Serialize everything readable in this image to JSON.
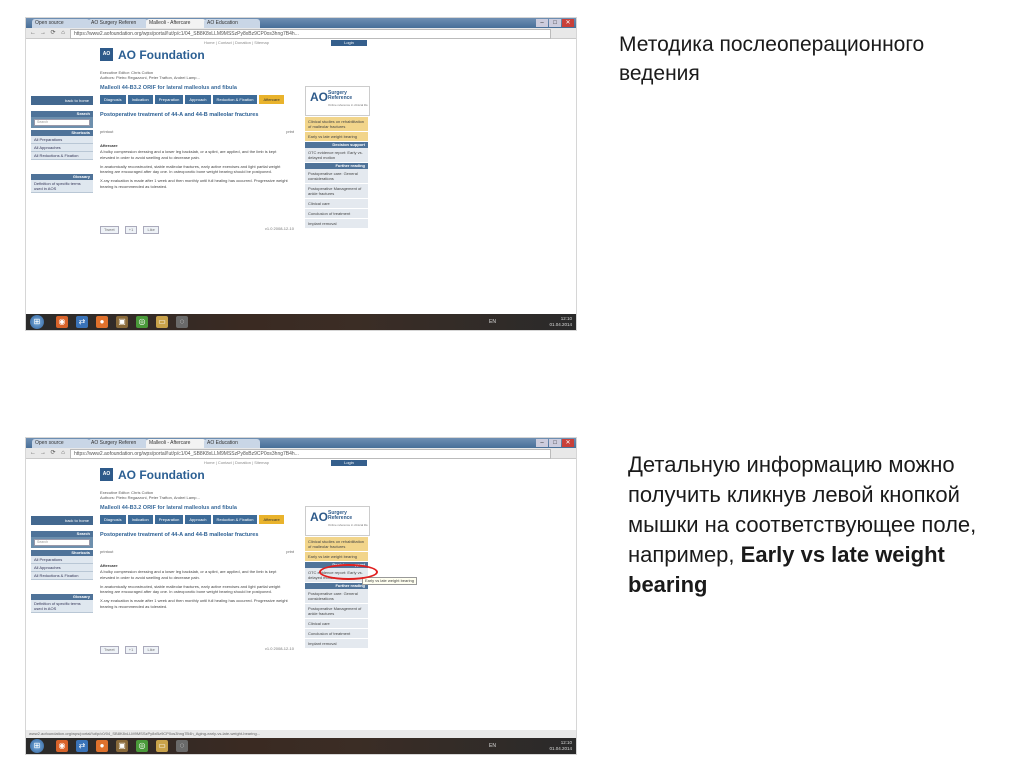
{
  "slides": {
    "caption1": "Методика послеоперационного ведения",
    "caption2_prefix": "Детальную информацию можно получить кликнув левой кнопкой мышки на соответствующее поле, например, ",
    "caption2_bold": "Early vs late weight bearing"
  },
  "browser": {
    "tabs": [
      "Open source",
      "AO Surgery Referen",
      "Malleoli - Aftercare",
      "AO Education"
    ],
    "url": "https://www2.aofoundation.org/wps/portal/!ut/p/c1/04_SB8K8xLLM9MSSzPy8xBz9CP0os3hng7B4h...",
    "window_buttons": [
      "–",
      "□",
      "✕"
    ],
    "nav_icons": [
      "←",
      "→",
      "⟳",
      "⌂"
    ]
  },
  "page": {
    "top_links": "Home | Contact | Donation | Sitemap",
    "login": "Login",
    "logo_mark": "AO",
    "org_name": "AO Foundation",
    "editors_line1": "Executive Editor: Chris Colton",
    "editors_line2": "Authors: Pietro Regazzoni, Peter Trafton, Andrei Lamp...",
    "title": "Malleoli 44-B3.2 ORIF for lateral malleolus and fibula",
    "nav_tabs": [
      "Diagnosis",
      "Indication",
      "Preparation",
      "Approach",
      "Reduction & Fixation",
      "Aftercare"
    ],
    "active_tab": "Aftercare",
    "section_title": "Postoperative treatment of 44-A and 44-B malleolar fractures",
    "print_left": "printout",
    "print_right": "print",
    "aftercare_heading": "Aftercare",
    "paragraphs": [
      "A bulky compression dressing and a lower leg backslab, or a splint, are applied, and the limb is kept elevated in order to avoid swelling and to decrease pain.",
      "In anatomically reconstructed, stable malleolar fractures, early active exercises and light partial weight bearing are encouraged after day one. In osteoporotic bone weight bearing should be postponed.",
      "X-ray evaluation is made after 1 week and then monthly until full healing has occurred. Progressive weight bearing is recommended as tolerated."
    ],
    "social": [
      "Tweet",
      "+1",
      "Like"
    ],
    "social_date": "v1.0 2008-12-10"
  },
  "left_sidebar": {
    "back_label": "back to home",
    "search_header": "Search",
    "search_placeholder": "Search",
    "shortcuts_header": "Shortcuts",
    "shortcuts": [
      "All Preparations",
      "All Approaches",
      "All Reductions & Fixation"
    ],
    "glossary_header": "Glossary",
    "glossary_item": "Definition of specific terms used in AOS"
  },
  "right_sidebar": {
    "brand_big": "AO",
    "brand_line1": "Surgery",
    "brand_line2": "Reference",
    "brand_tag": "Online reference in clinical life",
    "yellow_items": [
      "Clinical studies on rehabilitation of malleolar fractures",
      "Early vs late weight bearing"
    ],
    "decision_header": "Decision support",
    "decision_item": "OTC evidence report: Early vs. delayed motion",
    "further_header": "Further reading",
    "further_items": [
      "Postoperative care: General considerations",
      "Postoperative Management of ankle fractures",
      "Clinical care",
      "Conclusion of treatment",
      "Implant removal"
    ]
  },
  "shot2_extras": {
    "tooltip": "Early vs late weight bearing",
    "status_url": "www2.aofoundation.org/wps/portal/!ut/p/c0/04_SB8K8xLLM9MSSzPy8xBz9CP0os3hng7B4h_Aging-early-vs-late-weight-bearing..."
  },
  "taskbar": {
    "start_icon": "windows-logo",
    "lang": "EN",
    "time": "12:10",
    "date": "01.04.2014"
  }
}
